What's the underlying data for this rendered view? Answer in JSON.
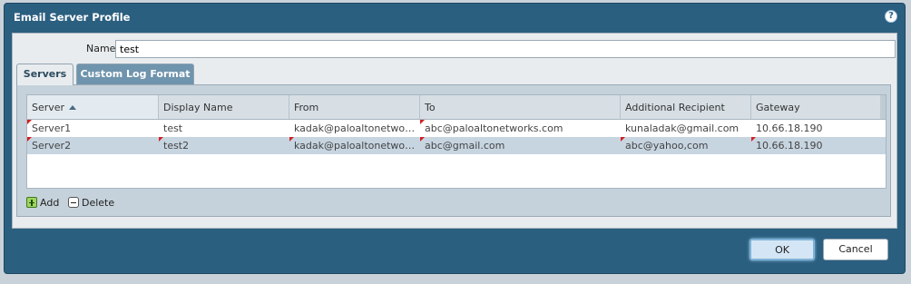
{
  "dialog": {
    "title": "Email Server Profile",
    "help_icon": "?",
    "name_label": "Name",
    "name_value": "test",
    "tabs": [
      {
        "label": "Servers",
        "active": true
      },
      {
        "label": "Custom Log Format",
        "active": false
      }
    ],
    "table": {
      "columns": [
        "Server",
        "Display Name",
        "From",
        "To",
        "Additional Recipient",
        "Gateway"
      ],
      "sorted_column": "Server",
      "sort_direction": "ascending",
      "rows": [
        [
          "Server1",
          "test",
          "kadak@paloaltonetworks.com",
          "abc@paloaltonetworks.com",
          "kunaladak@gmail.com",
          "10.66.18.190"
        ],
        [
          "Server2",
          "test2",
          "kadak@paloaltonetworks.com",
          "abc@gmail.com",
          "abc@yahoo,com",
          "10.66.18.190"
        ]
      ]
    },
    "toolbar": {
      "add_label": "Add",
      "delete_label": "Delete"
    },
    "buttons": {
      "ok_label": "OK",
      "cancel_label": "Cancel"
    }
  },
  "colors": {
    "dialog_bg": "#2b5f7f",
    "selected_row": "#c7d5e1",
    "modified_marker": "#d21f1f"
  },
  "icons": [
    "help-icon",
    "sort-ascending-icon",
    "add-icon",
    "delete-icon"
  ]
}
